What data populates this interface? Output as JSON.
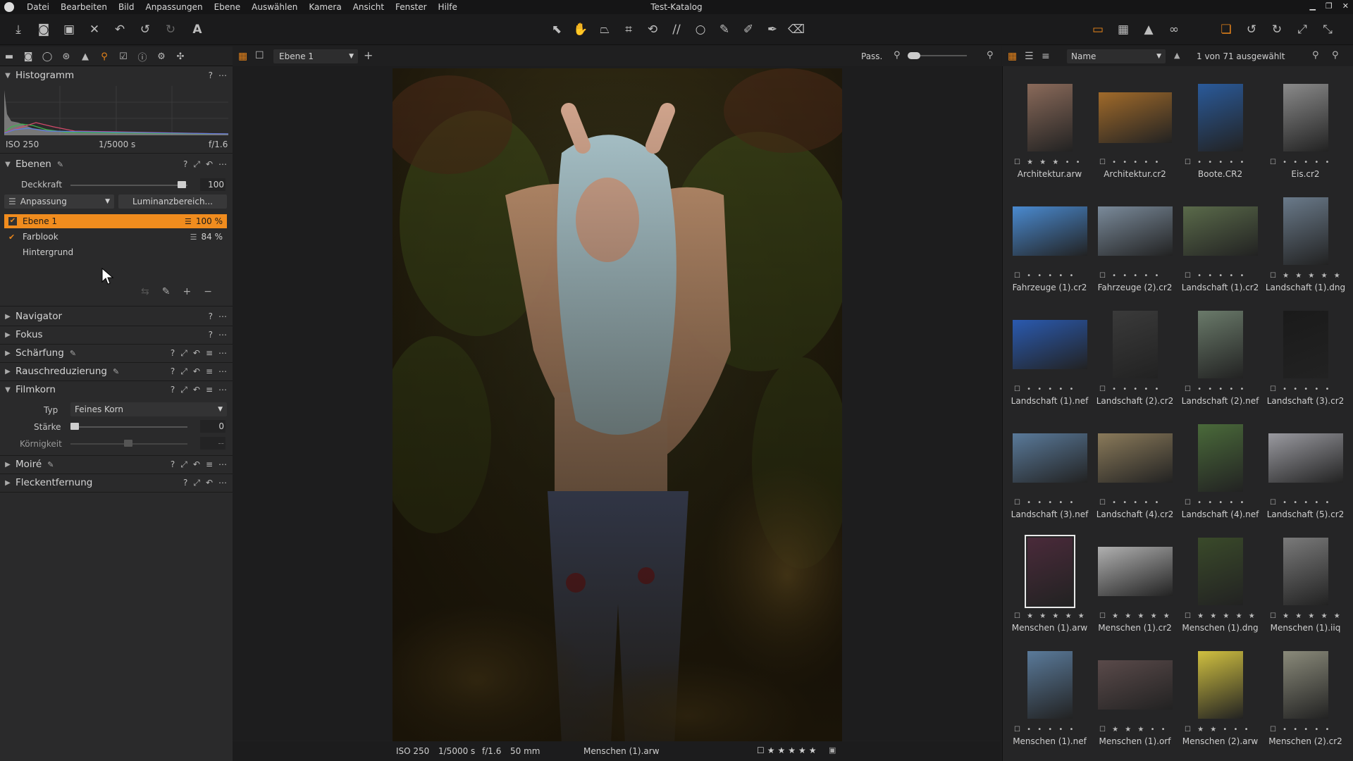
{
  "app": {
    "title": "Test-Katalog"
  },
  "menu": [
    "Datei",
    "Bearbeiten",
    "Bild",
    "Anpassungen",
    "Ebene",
    "Auswählen",
    "Kamera",
    "Ansicht",
    "Fenster",
    "Hilfe"
  ],
  "histogram": {
    "title": "Histogramm",
    "iso": "ISO 250",
    "shutter": "1/5000 s",
    "aperture": "f/1.6"
  },
  "layers": {
    "title": "Ebenen",
    "opacity_label": "Deckkraft",
    "opacity_value": "100",
    "adjust_label": "Anpassung",
    "luminance_label": "Luminanzbereich...",
    "items": [
      {
        "name": "Ebene 1",
        "value": "100 %"
      },
      {
        "name": "Farblook",
        "value": "84 %"
      },
      {
        "name": "Hintergrund",
        "value": ""
      }
    ]
  },
  "sections": {
    "navigator": "Navigator",
    "focus": "Fokus",
    "sharpen": "Schärfung",
    "noise": "Rauschreduzierung",
    "grain": "Filmkorn",
    "moire": "Moiré",
    "spot": "Fleckentfernung"
  },
  "grain": {
    "type_label": "Typ",
    "type_value": "Feines Korn",
    "strength_label": "Stärke",
    "strength_value": "0",
    "grain_label": "Körnigkeit",
    "grain_value": "--"
  },
  "viewer": {
    "layer_select": "Ebene 1",
    "fit_label": "Pass."
  },
  "status": {
    "iso": "ISO 250",
    "shutter": "1/5000 s",
    "aperture": "f/1.6",
    "focal": "50 mm",
    "file": "Menschen (1).arw"
  },
  "browser": {
    "sort_label": "Name",
    "selection": "1 von 71 ausgewählt",
    "items": [
      {
        "name": "Architektur.arw",
        "stars": "☐ ★ ★ ★ • •"
      },
      {
        "name": "Architektur.cr2",
        "stars": "☐ • • • • •"
      },
      {
        "name": "Boote.CR2",
        "stars": "☐ • • • • •"
      },
      {
        "name": "Eis.cr2",
        "stars": "☐ • • • • •"
      },
      {
        "name": "Fahrzeuge (1).cr2",
        "stars": "☐ • • • • •"
      },
      {
        "name": "Fahrzeuge (2).cr2",
        "stars": "☐ • • • • •"
      },
      {
        "name": "Landschaft (1).cr2",
        "stars": "☐ • • • • •"
      },
      {
        "name": "Landschaft (1).dng",
        "stars": "☐ ★ ★ ★ ★ ★"
      },
      {
        "name": "Landschaft (1).nef",
        "stars": "☐ • • • • •"
      },
      {
        "name": "Landschaft (2).cr2",
        "stars": "☐ • • • • •"
      },
      {
        "name": "Landschaft (2).nef",
        "stars": "☐ • • • • •"
      },
      {
        "name": "Landschaft (3).cr2",
        "stars": "☐ • • • • •"
      },
      {
        "name": "Landschaft (3).nef",
        "stars": "☐ • • • • •"
      },
      {
        "name": "Landschaft (4).cr2",
        "stars": "☐ • • • • •"
      },
      {
        "name": "Landschaft (4).nef",
        "stars": "☐ • • • • •"
      },
      {
        "name": "Landschaft (5).cr2",
        "stars": "☐ • • • • •"
      },
      {
        "name": "Menschen (1).arw",
        "stars": "☐ ★ ★ ★ ★ ★"
      },
      {
        "name": "Menschen (1).cr2",
        "stars": "☐ ★ ★ ★ ★ ★"
      },
      {
        "name": "Menschen (1).dng",
        "stars": "☐ ★ ★ ★ ★ ★"
      },
      {
        "name": "Menschen (1).iiq",
        "stars": "☐ ★ ★ ★ ★ ★"
      },
      {
        "name": "Menschen (1).nef",
        "stars": "☐ • • • • •"
      },
      {
        "name": "Menschen (1).orf",
        "stars": "☐ ★ ★ ★ • •"
      },
      {
        "name": "Menschen (2).arw",
        "stars": "☐ ★ ★ • • •"
      },
      {
        "name": "Menschen (2).cr2",
        "stars": "☐ • • • • •"
      }
    ]
  },
  "colors": {
    "accent": "#e8841a",
    "selected_layer": "#f08c1e",
    "panel": "#2a2a2b"
  }
}
